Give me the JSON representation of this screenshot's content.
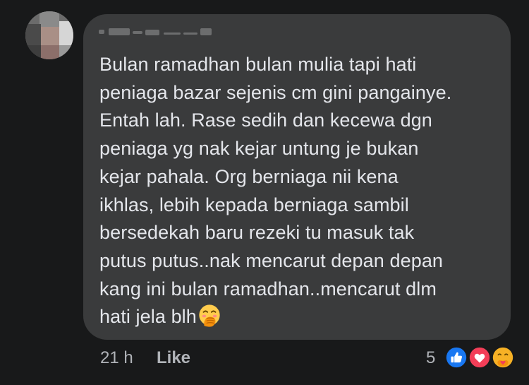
{
  "comment": {
    "lines": [
      "Bulan ramadhan bulan mulia tapi hati",
      "peniaga bazar sejenis cm gini pangainye.",
      "Entah lah. Rase sedih dan kecewa dgn",
      "peniaga yg nak kejar untung je bukan",
      "kejar pahala. Org berniaga nii kena",
      "ikhlas, lebih kepada berniaga sambil",
      "bersedekah baru rezeki tu masuk tak",
      "putus putus..nak mencarut depan depan",
      "kang ini bulan ramadhan..mencarut dlm",
      "hati jela blh"
    ],
    "emoji": "face-with-hand-over-mouth"
  },
  "footer": {
    "time": "21 h",
    "like_label": "Like",
    "reaction_count": "5"
  },
  "reactions": [
    "like-icon",
    "love-icon",
    "care-icon"
  ],
  "colors": {
    "background": "#18191a",
    "bubble": "#3a3b3c",
    "text": "#e4e6eb",
    "secondary_text": "#b0b3b8",
    "like_blue": "#1877f2",
    "love_red": "#f33e58",
    "care_yellow": "#f7b125"
  }
}
